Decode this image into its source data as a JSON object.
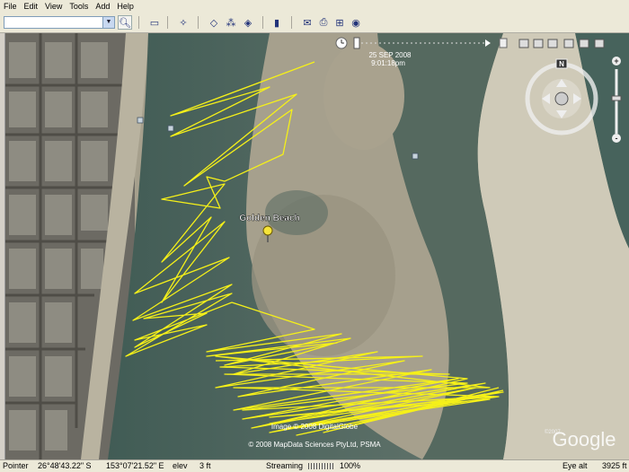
{
  "menu": [
    "File",
    "Edit",
    "View",
    "Tools",
    "Add",
    "Help"
  ],
  "search": {
    "value": ""
  },
  "timeline": {
    "date": "25 SEP 2008",
    "time": "9:01:18pm"
  },
  "placemark": {
    "label": "Golden Beach"
  },
  "credits": {
    "line1": "Image © 2008 DigitalGlobe",
    "line2": "© 2008 MapData Sciences PtyLtd, PSMA",
    "corner": "©2007"
  },
  "logo": "Google",
  "nav": {
    "north": "N",
    "zoom_in": "+",
    "zoom_out": "-"
  },
  "status": {
    "pointer_label": "Pointer",
    "lat": "26°48'43.22\" S",
    "lon": "153°07'21.52\" E",
    "elev_label": "elev",
    "elev": "3 ft",
    "streaming_label": "Streaming",
    "streaming_pct": "100%",
    "eye_label": "Eye alt",
    "eye_alt": "3925 ft"
  },
  "colors": {
    "track": "#f5f019",
    "water": "#3f5e54",
    "sand": "#9f9a87"
  }
}
